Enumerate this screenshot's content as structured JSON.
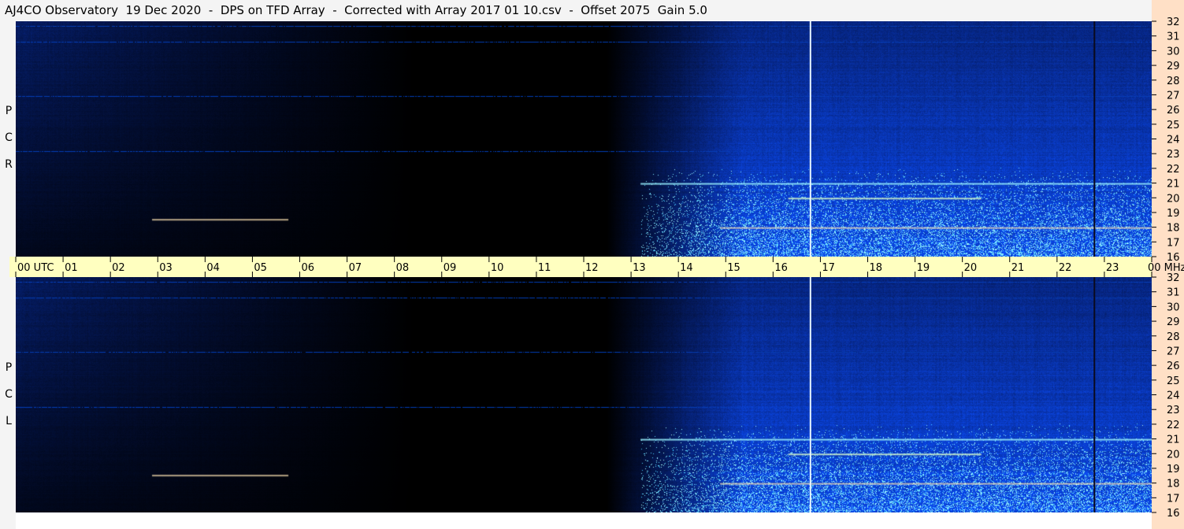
{
  "chart_data": {
    "type": "heatmap",
    "title": "AJ4CO Observatory  19 Dec 2020  -  DPS on TFD Array  -  Corrected with Array 2017 01 10.csv  -  Offset 2075  Gain 5.0",
    "x_unit": "UTC",
    "y_unit": "MHz",
    "x_ticks": [
      "00",
      "01",
      "02",
      "03",
      "04",
      "05",
      "06",
      "07",
      "08",
      "09",
      "10",
      "11",
      "12",
      "13",
      "14",
      "15",
      "16",
      "17",
      "18",
      "19",
      "20",
      "21",
      "22",
      "23",
      "00"
    ],
    "y_ticks": [
      "32",
      "31",
      "30",
      "29",
      "28",
      "27",
      "26",
      "25",
      "24",
      "23",
      "22",
      "21",
      "20",
      "19",
      "18",
      "17",
      "16"
    ],
    "xlim": [
      0,
      24
    ],
    "ylim": [
      16,
      32
    ],
    "panels": [
      {
        "label": "RCP",
        "letters": [
          "R",
          "C",
          "P"
        ]
      },
      {
        "label": "LCP",
        "letters": [
          "L",
          "C",
          "P"
        ]
      }
    ],
    "markers_utc": [
      16.79,
      22.79
    ],
    "colors": {
      "background": "#000000",
      "sky_high": "#1e50e6",
      "sky_low": "#0a1e78",
      "hot": "#40f0ff",
      "axis_band": "#ffffc0",
      "frame": "#ffe0c6"
    }
  }
}
